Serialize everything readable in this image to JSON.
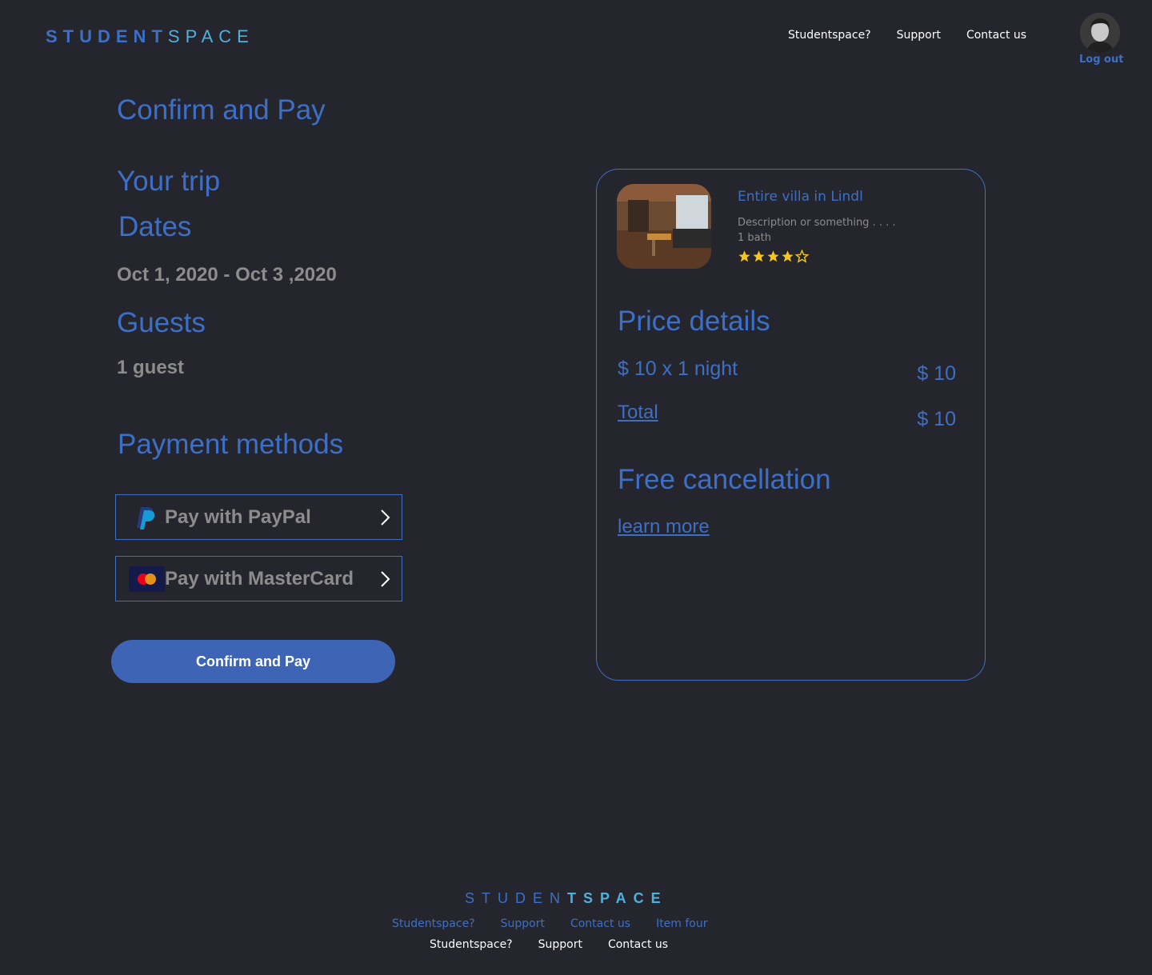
{
  "header": {
    "logo": {
      "part1": "STUDEN",
      "part2": "T",
      "part3": "SPACE"
    },
    "nav": [
      "Studentspace?",
      "Support",
      "Contact us"
    ],
    "logout": "Log out"
  },
  "main": {
    "title": "Confirm and Pay",
    "trip_heading": "Your trip",
    "dates_heading": "Dates",
    "dates_value": "Oct 1, 2020 - Oct 3 ,2020",
    "guests_heading": "Guests",
    "guests_value": "1 guest",
    "payment_heading": "Payment methods",
    "paypal_label": "Pay with PayPal",
    "mastercard_label": "Pay with MasterCard",
    "confirm_label": "Confirm and Pay"
  },
  "listing": {
    "title": "Entire villa in Lindl",
    "description": "Description or something . . . .",
    "bath": "1 bath",
    "rating": {
      "value": 4,
      "max": 5
    },
    "price_heading": "Price details",
    "price_line_label": "$ 10 x 1 night",
    "price_line_value": "$ 10",
    "total_label": "Total",
    "total_value": "$ 10",
    "cancellation_heading": "Free cancellation",
    "learn_more": "learn more"
  },
  "footer": {
    "logo": {
      "part1": "STUDEN",
      "part2": "TSPACE"
    },
    "links_row1": [
      "Studentspace?",
      "Support",
      "Contact us",
      "Item four"
    ],
    "links_row2": [
      "Studentspace?",
      "Support",
      "Contact us"
    ]
  },
  "colors": {
    "background": "#25262d",
    "accent": "#3d6fc7",
    "accent_light": "#4fb0df",
    "muted": "#8c8c8c",
    "button": "#3d64b5",
    "star": "#f5c518"
  },
  "icons": [
    "paypal-icon",
    "mastercard-icon",
    "chevron-right-icon",
    "star-icon",
    "avatar-photo"
  ]
}
